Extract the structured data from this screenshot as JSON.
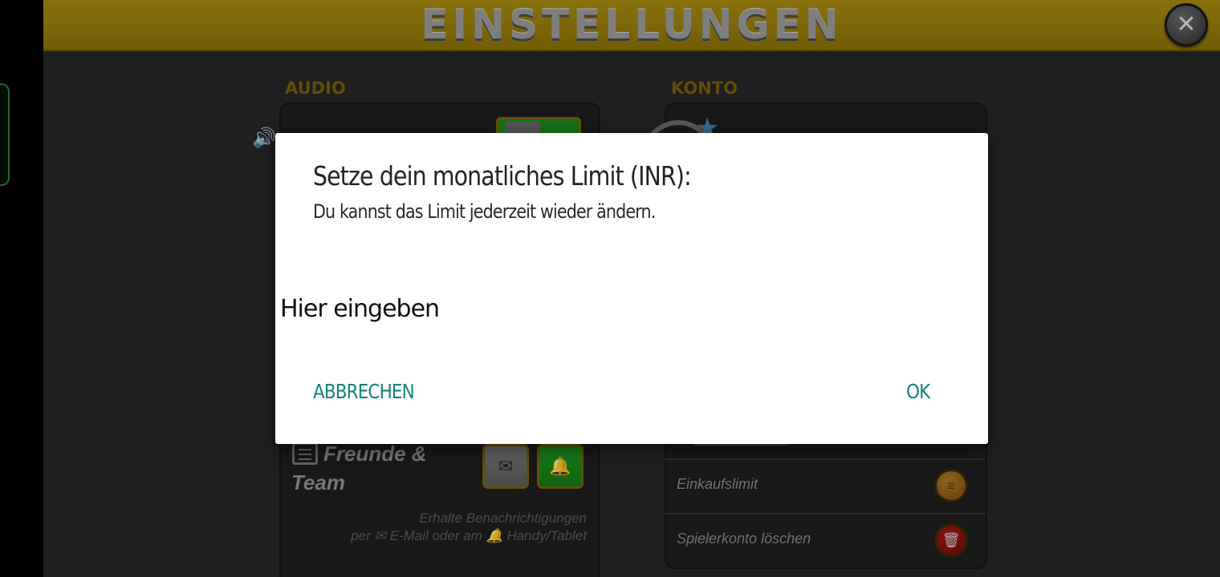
{
  "header": {
    "title": "EINSTELLUNGEN",
    "close_icon": "close-icon"
  },
  "sections": {
    "audio": {
      "label": "AUDIO"
    },
    "konto": {
      "label": "KONTO"
    }
  },
  "friends": {
    "title": "Freunde & Team",
    "email_icon": "envelope-icon",
    "push_icon": "bell-icon",
    "note_line1": "Erhalte Benachrichtigungen",
    "note_line2": "per ✉ E-Mail oder am 🔔 Handy/Tablet"
  },
  "konto_rows": [
    {
      "label": "Einkaufslimit",
      "icon": "coins-icon"
    },
    {
      "label": "Spielerkonto löschen",
      "icon": "trash-icon"
    }
  ],
  "dialog": {
    "title": "Setze dein monatliches Limit (INR):",
    "message": "Du kannst das Limit jederzeit wieder ändern.",
    "input_placeholder": "Hier eingeben",
    "input_value": "",
    "cancel_label": "ABBRECHEN",
    "ok_label": "OK"
  },
  "colors": {
    "header_bg": "#a88a10",
    "section_label": "#7a5e08",
    "dialog_button": "#128478",
    "toggle_green": "#1d8a1d",
    "delete_red": "#a31818"
  }
}
